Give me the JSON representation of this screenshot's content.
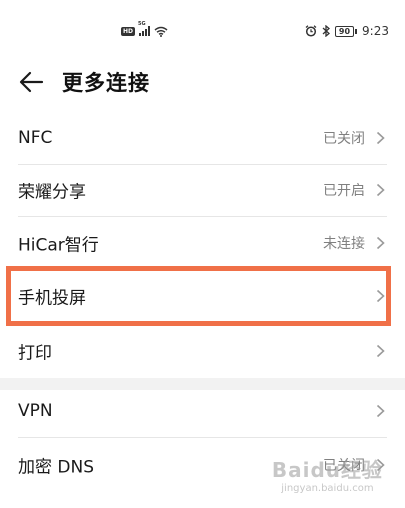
{
  "status_bar": {
    "hd": "HD",
    "network": "5G",
    "time": "9:23",
    "battery": "90"
  },
  "header": {
    "title": "更多连接",
    "back_icon": "arrow-left-icon"
  },
  "list": [
    {
      "label": "NFC",
      "value": "已关闭"
    },
    {
      "label": "荣耀分享",
      "value": "已开启"
    },
    {
      "label": "HiCar智行",
      "value": "未连接"
    },
    {
      "label": "手机投屏",
      "value": ""
    },
    {
      "label": "打印",
      "value": ""
    },
    {
      "label": "VPN",
      "value": ""
    },
    {
      "label": "加密 DNS",
      "value": "已关闭"
    }
  ],
  "watermark": {
    "logo": "Baidu经验",
    "url": "jingyan.baidu.com"
  },
  "colors": {
    "highlight": "#f07048",
    "value_text": "#808080"
  }
}
